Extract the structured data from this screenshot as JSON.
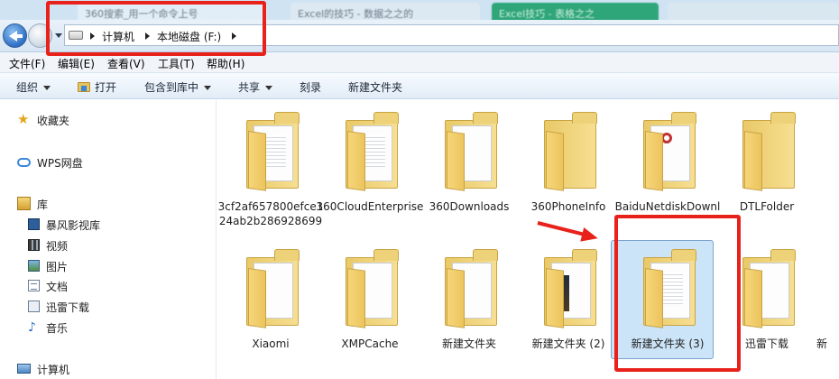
{
  "browser_tabs": [
    {
      "label": "360搜索_用一个命令上号"
    },
    {
      "label": "Excel的技巧 - 数据之之的"
    },
    {
      "label": "Excel技巧 - 表格之之"
    },
    {
      "label": ""
    }
  ],
  "address": {
    "crumbs": [
      "计算机",
      "本地磁盘 (F:)"
    ]
  },
  "menu": [
    "文件(F)",
    "编辑(E)",
    "查看(V)",
    "工具(T)",
    "帮助(H)"
  ],
  "commands": {
    "organize": "组织",
    "open": "打开",
    "include_in_library": "包含到库中",
    "share": "共享",
    "burn": "刻录",
    "new_folder": "新建文件夹"
  },
  "nav": {
    "favorites": "收藏夹",
    "wps": "WPS网盘",
    "libraries": "库",
    "lib_items": [
      "暴风影视库",
      "视频",
      "图片",
      "文档",
      "迅雷下载",
      "音乐"
    ],
    "computer": "计算机"
  },
  "folders": [
    {
      "name": "3cf2af657800efce124ab2b286928699"
    },
    {
      "name": "360CloudEnterprise"
    },
    {
      "name": "360Downloads"
    },
    {
      "name": "360PhoneInfo"
    },
    {
      "name": "BaiduNetdiskDownload"
    },
    {
      "name": "DTLFolder"
    },
    {
      "name": "Xiaomi"
    },
    {
      "name": "XMPCache"
    },
    {
      "name": "新建文件夹"
    },
    {
      "name": "新建文件夹 (2)"
    },
    {
      "name": "新建文件夹 (3)"
    },
    {
      "name": "迅雷下载"
    },
    {
      "name": "新"
    }
  ],
  "colors": {
    "annotation": "#e8211b",
    "selection": "#cce4f7",
    "folder": "#f2d27a"
  }
}
